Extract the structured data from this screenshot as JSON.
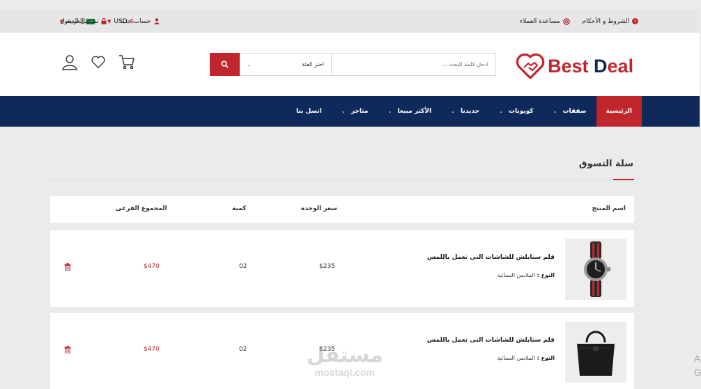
{
  "topbar": {
    "terms": "الشروط و الأحكام",
    "help": "مساعدة العملاء",
    "language": "العربية",
    "currency": "USD",
    "login": "تسجيل الدخول",
    "new_account": "حساب جديد"
  },
  "header": {
    "logo_part1": "Best ",
    "logo_d": "D",
    "logo_part2": "eal",
    "search_placeholder": "ادخل كلمة للبحث...",
    "category_label": "اختر الفئة"
  },
  "nav": {
    "items": [
      {
        "label": "الرئيسية"
      },
      {
        "label": "صفقات"
      },
      {
        "label": "كوبونات"
      },
      {
        "label": "جديدنا"
      },
      {
        "label": "الأكثر مبيعا"
      },
      {
        "label": "متاجر"
      },
      {
        "label": "اتصل بنا"
      }
    ]
  },
  "cart": {
    "title": "سلة التسوق",
    "headers": {
      "product": "اسم المنتج",
      "unit_price": "سعر الوحدة",
      "quantity": "كمية",
      "subtotal": "المجموع الفرعى"
    },
    "rows": [
      {
        "name": "قلم ستايلش للشاشات التى تعمل باللمس",
        "type_label": "النوع :",
        "type_value": "الملابس النسائية",
        "price": "$235",
        "qty": "02",
        "subtotal": "$470"
      },
      {
        "name": "قلم ستايلش للشاشات التى تعمل باللمس",
        "type_label": "النوع :",
        "type_value": "الملابس النسائية",
        "price": "$235",
        "qty": "02",
        "subtotal": "$470"
      }
    ]
  },
  "watermark": {
    "arabic": "مستقل",
    "latin": "mostaql.com"
  },
  "edge_text": [
    "A",
    "G"
  ],
  "colors": {
    "accent": "#c0272d",
    "navy": "#0f2a5a"
  },
  "icons": [
    "question-icon",
    "lifebuoy-icon",
    "flag-icon",
    "dollar-icon",
    "lock-icon",
    "user-icon",
    "search-icon",
    "cart-icon",
    "heart-icon",
    "trash-icon"
  ]
}
